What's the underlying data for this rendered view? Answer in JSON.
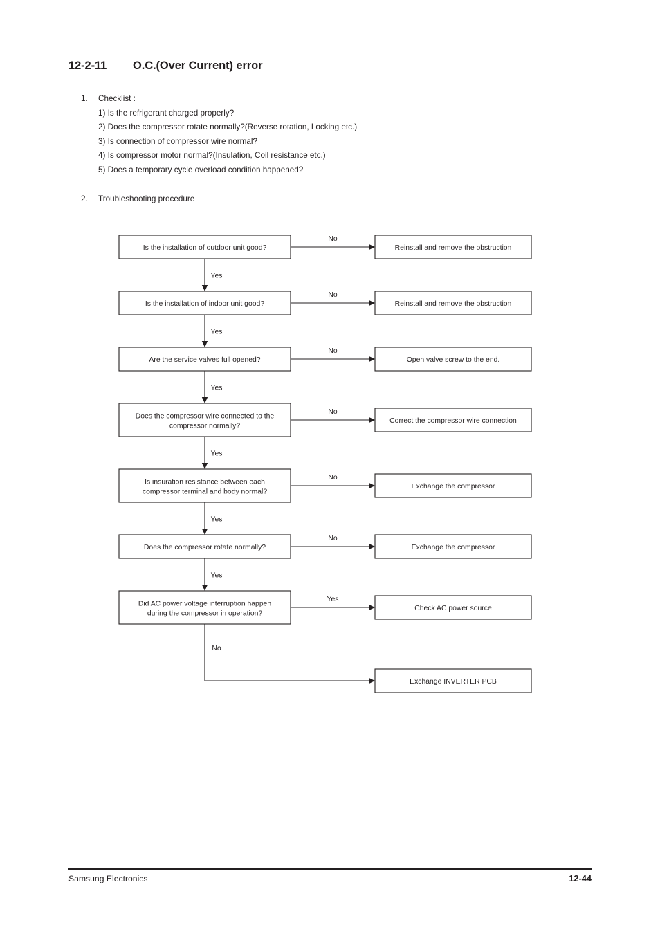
{
  "heading": {
    "number": "12-2-11",
    "title": "O.C.(Over Current) error"
  },
  "sections": {
    "checklist": {
      "marker": "1.",
      "title": "Checklist :",
      "items": [
        "1) Is the refrigerant charged properly?",
        "2) Does the compressor rotate normally?(Reverse rotation, Locking etc.)",
        "3) Is connection of compressor wire normal?",
        "4) Is compressor motor normal?(Insulation, Coil resistance etc.)",
        "5) Does a temporary cycle overload condition happened?"
      ]
    },
    "procedure": {
      "marker": "2.",
      "title": "Troubleshooting procedure"
    }
  },
  "flowchart": {
    "rows": [
      {
        "question": "Is the installation of outdoor unit good?",
        "question_line2": "",
        "branch_label": "No",
        "action": "Reinstall and remove the obstruction",
        "next_label": "Yes"
      },
      {
        "question": "Is the installation of indoor unit good?",
        "question_line2": "",
        "branch_label": "No",
        "action": "Reinstall and remove the obstruction",
        "next_label": "Yes"
      },
      {
        "question": "Are the service valves full opened?",
        "question_line2": "",
        "branch_label": "No",
        "action": "Open valve screw to the end.",
        "next_label": "Yes"
      },
      {
        "question": "Does the compressor wire connected to the",
        "question_line2": "compressor normally?",
        "branch_label": "No",
        "action": "Correct the compressor wire connection",
        "next_label": "Yes"
      },
      {
        "question": "Is insuration resistance between each",
        "question_line2": "compressor terminal and body normal?",
        "branch_label": "No",
        "action": "Exchange the compressor",
        "next_label": "Yes"
      },
      {
        "question": "Does the compressor rotate normally?",
        "question_line2": "",
        "branch_label": "No",
        "action": "Exchange the compressor",
        "next_label": "Yes"
      },
      {
        "question": "Did AC power voltage interruption happen",
        "question_line2": "during the compressor in operation?",
        "branch_label": "Yes",
        "action": "Check AC power source",
        "next_label": "No"
      }
    ],
    "terminal_action": "Exchange INVERTER PCB"
  },
  "footer": {
    "company": "Samsung Electronics",
    "page": "12-44"
  }
}
